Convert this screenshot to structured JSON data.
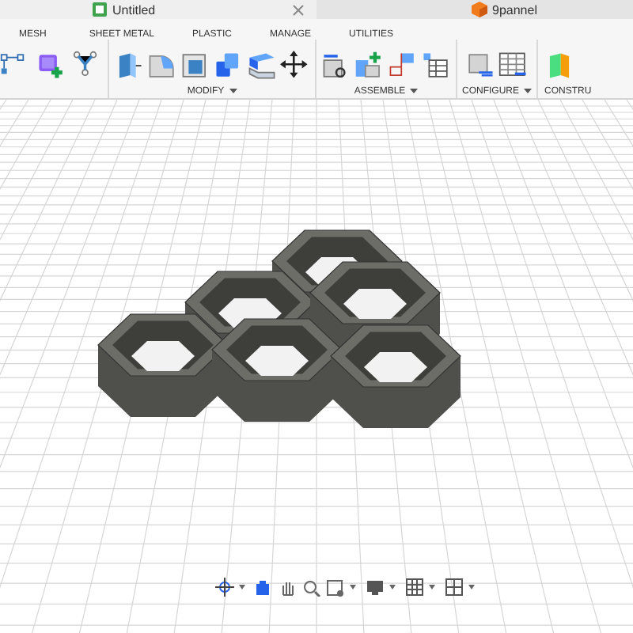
{
  "tabs": [
    {
      "label": "Untitled",
      "selected": true
    },
    {
      "label": "9pannel",
      "selected": false
    }
  ],
  "toolbar_tabs": [
    "MESH",
    "SHEET METAL",
    "PLASTIC",
    "MANAGE",
    "UTILITIES"
  ],
  "groups": [
    {
      "kind": "mesh"
    },
    {
      "kind": "modify",
      "label": "MODIFY"
    },
    {
      "kind": "assemble",
      "label": "ASSEMBLE"
    },
    {
      "kind": "configure",
      "label": "CONFIGURE"
    },
    {
      "kind": "construct",
      "label": "CONSTRU"
    }
  ]
}
